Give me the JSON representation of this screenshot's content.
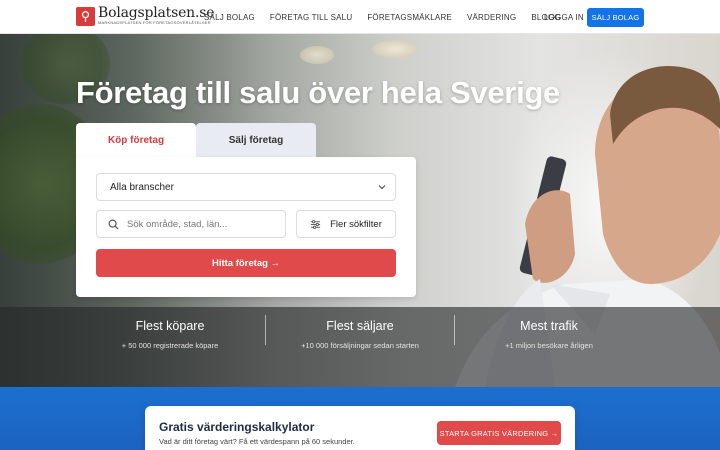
{
  "header": {
    "logo_name": "Bolagsplatsen.se",
    "logo_tagline": "Marknadsplatsen för företagsöverlåtelser",
    "nav": [
      "SÄLJ BOLAG",
      "FÖRETAG TILL SALU",
      "FÖRETAGSMÄKLARE",
      "VÄRDERING",
      "BLOGG"
    ],
    "login": "LOGGA IN",
    "sell_button": "SÄLJ BOLAG"
  },
  "hero": {
    "title": "Företag till salu över hela Sverige",
    "tabs": {
      "buy": "Köp företag",
      "sell": "Sälj företag"
    },
    "industry_select": "Alla branscher",
    "search_placeholder": "Sök område, stad, län...",
    "more_filters": "Fler sökfilter",
    "find_button": "Hitta företag →"
  },
  "stats": [
    {
      "title": "Flest köpare",
      "sub": "+ 50 000 registrerade köpare"
    },
    {
      "title": "Flest säljare",
      "sub": "+10 000 försäljningar sedan starten"
    },
    {
      "title": "Mest trafik",
      "sub": "+1 miljon besökare årligen"
    }
  ],
  "valuation": {
    "title": "Gratis värderingskalkylator",
    "subtitle": "Vad är ditt företag värt? Få ett värdespann på 60 sekunder.",
    "button": "STARTA GRATIS VÄRDERING →"
  },
  "colors": {
    "brand_red": "#e04a4a",
    "brand_blue": "#1473e6"
  }
}
